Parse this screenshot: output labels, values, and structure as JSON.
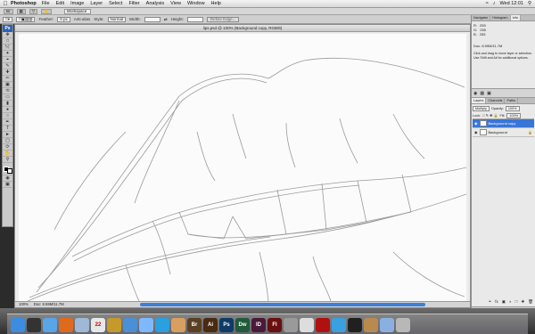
{
  "menubar": {
    "app_name": "Photoshop",
    "items": [
      "File",
      "Edit",
      "Image",
      "Layer",
      "Select",
      "Filter",
      "Analysis",
      "View",
      "Window",
      "Help"
    ],
    "clock": "Wed 12:01"
  },
  "app_strip": {
    "workspace_label": "Workspace"
  },
  "options_bar": {
    "feather_label": "Feather:",
    "feather_value": "0 px",
    "antialias_label": "Anti-alias",
    "style_label": "Style:",
    "style_value": "Normal",
    "width_label": "Width:",
    "height_label": "Height:",
    "refine_edge_label": "Refine Edge..."
  },
  "document": {
    "title": "lips.psd @ 100% (Background copy, RGB/8)",
    "zoom": "100%",
    "doc_size": "Doc: 8.59M/11.7M"
  },
  "info_panel": {
    "tabs": [
      "Navigator",
      "Histogram",
      "Info"
    ],
    "r_label": "R:",
    "r_value": "255",
    "g_label": "G:",
    "g_value": "255",
    "b_label": "B:",
    "b_value": "255",
    "doc_text": "Doc: 8.59M/11.7M",
    "hint": "Click and drag to move layer or selection. Use Shift and Alt for additional options."
  },
  "layers_panel": {
    "tabs": [
      "Layers",
      "Channels",
      "Paths"
    ],
    "blend_mode": "Multiply",
    "opacity_label": "Opacity:",
    "opacity_value": "100%",
    "lock_label": "Lock:",
    "fill_label": "Fill:",
    "fill_value": "100%",
    "layers": [
      {
        "name": "Background copy",
        "selected": true
      },
      {
        "name": "Background",
        "selected": false
      }
    ]
  },
  "dock": {
    "icons": [
      {
        "icon": "finder-icon",
        "label": "",
        "color": "#3c8de0"
      },
      {
        "icon": "dashboard-icon",
        "label": "",
        "color": "#333333"
      },
      {
        "icon": "safari-icon",
        "label": "",
        "color": "#5aa4e8"
      },
      {
        "icon": "firefox-icon",
        "label": "",
        "color": "#e06a1c"
      },
      {
        "icon": "mail-icon",
        "label": "",
        "color": "#a0b8d8"
      },
      {
        "icon": "ical-icon",
        "label": "22",
        "color": "#e8e8e8"
      },
      {
        "icon": "cyberduck-icon",
        "label": "",
        "color": "#c69a2a"
      },
      {
        "icon": "itunes-icon",
        "label": "",
        "color": "#4a8fd8"
      },
      {
        "icon": "ichat-icon",
        "label": "",
        "color": "#7fb8ff"
      },
      {
        "icon": "skype-icon",
        "label": "",
        "color": "#2aa0e0"
      },
      {
        "icon": "photo-icon",
        "label": "",
        "color": "#d8a060"
      },
      {
        "icon": "bridge-icon",
        "label": "Br",
        "color": "#5a3f22"
      },
      {
        "icon": "illustrator-icon",
        "label": "Ai",
        "color": "#4a2a10"
      },
      {
        "icon": "photoshop-icon",
        "label": "Ps",
        "color": "#0f3b66"
      },
      {
        "icon": "dreamweaver-icon",
        "label": "Dw",
        "color": "#1f5a3a"
      },
      {
        "icon": "indesign-icon",
        "label": "ID",
        "color": "#4a1a3a"
      },
      {
        "icon": "flash-icon",
        "label": "Fl",
        "color": "#6a0f0f"
      },
      {
        "icon": "preview-icon",
        "label": "",
        "color": "#9a9a9a"
      },
      {
        "icon": "textedit-icon",
        "label": "",
        "color": "#dddddd"
      },
      {
        "icon": "acrobat-icon",
        "label": "",
        "color": "#b01010"
      },
      {
        "icon": "quicktime-icon",
        "label": "",
        "color": "#3aa0e0"
      },
      {
        "icon": "terminal-icon",
        "label": "",
        "color": "#202020"
      },
      {
        "icon": "stacks-icon",
        "label": "",
        "color": "#b88a50"
      },
      {
        "icon": "documents-icon",
        "label": "",
        "color": "#8ab0e0"
      },
      {
        "icon": "trash-icon",
        "label": "",
        "color": "#b8b8b8"
      }
    ]
  }
}
